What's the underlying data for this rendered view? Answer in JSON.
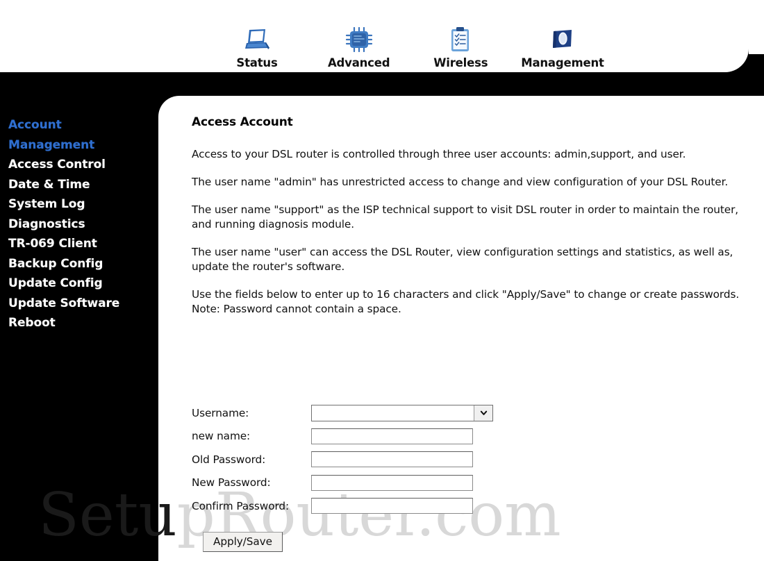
{
  "topnav": {
    "items": [
      {
        "label": "Status",
        "icon": "laptop-icon"
      },
      {
        "label": "Advanced",
        "icon": "cpu-chip-icon"
      },
      {
        "label": "Wireless",
        "icon": "clipboard-checklist-icon"
      },
      {
        "label": "Management",
        "icon": "flag-banner-icon"
      }
    ]
  },
  "sidebar": {
    "items": [
      {
        "label": "Account\nManagement",
        "active": true
      },
      {
        "label": "Access Control",
        "active": false
      },
      {
        "label": "Date & Time",
        "active": false
      },
      {
        "label": "System Log",
        "active": false
      },
      {
        "label": "Diagnostics",
        "active": false
      },
      {
        "label": "TR-069 Client",
        "active": false
      },
      {
        "label": "Backup Config",
        "active": false
      },
      {
        "label": "Update Config",
        "active": false
      },
      {
        "label": "Update Software",
        "active": false
      },
      {
        "label": "Reboot",
        "active": false
      }
    ],
    "active_color": "#2f6fd0",
    "text_color": "#ffffff",
    "background": "#000000"
  },
  "main": {
    "title": "Access Account",
    "paragraphs": [
      "Access to your DSL router is controlled through three user accounts: admin,support, and user.",
      "The user name \"admin\" has unrestricted access to change and view configuration of your DSL Router.",
      "The user name \"support\" as the ISP technical support to visit DSL router in order to maintain the router, and running diagnosis module.",
      "The user name \"user\" can access the DSL Router, view configuration settings and statistics, as well as, update the router's software.",
      "Use the fields below to enter up to 16 characters and click \"Apply/Save\" to change or create passwords. Note: Password cannot contain a space."
    ]
  },
  "form": {
    "username_label": "Username:",
    "username_value": "",
    "new_name_label": "new name:",
    "new_name_value": "",
    "old_password_label": "Old Password:",
    "old_password_value": "",
    "new_password_label": "New Password:",
    "new_password_value": "",
    "confirm_password_label": "Confirm Password:",
    "confirm_password_value": "",
    "apply_label": "Apply/Save"
  },
  "watermark": {
    "part_dark": "Setu",
    "part_light": "pRouter.com"
  }
}
